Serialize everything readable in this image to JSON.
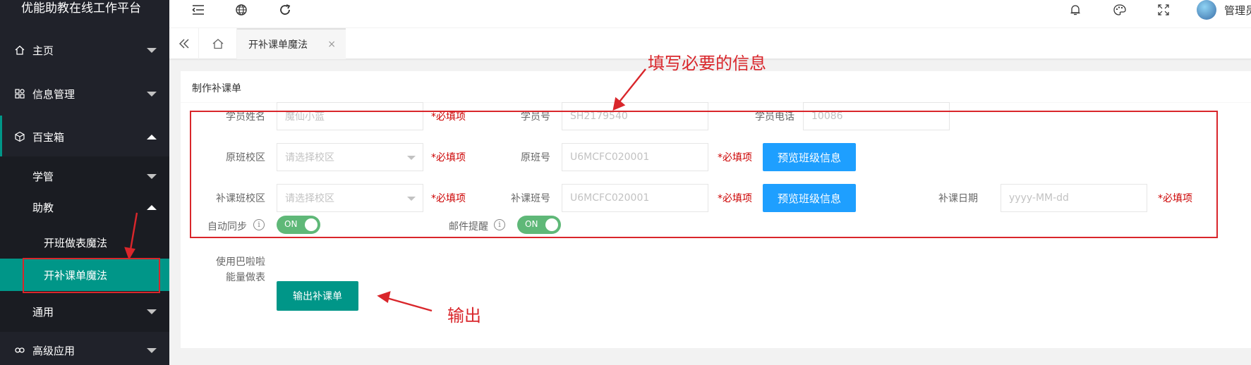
{
  "app": {
    "title": "优能助教在线工作平台"
  },
  "sidebar": {
    "items": [
      {
        "label": "主页",
        "icon": "home-icon",
        "caret": "down"
      },
      {
        "label": "信息管理",
        "icon": "apps-icon",
        "caret": "down"
      },
      {
        "label": "百宝箱",
        "icon": "cube-icon",
        "caret": "up"
      },
      {
        "label": "高级应用",
        "icon": "link-icon",
        "caret": "down"
      }
    ],
    "sub_items": [
      {
        "label": "学管",
        "caret": "down"
      },
      {
        "label": "助教",
        "caret": "up"
      },
      {
        "label": "通用",
        "caret": "down"
      }
    ],
    "sub_sub_items": [
      {
        "label": "开班做表魔法"
      },
      {
        "label": "开补课单魔法"
      }
    ]
  },
  "topbar": {
    "icons": [
      "menu-fold-icon",
      "globe-icon",
      "refresh-icon",
      "bell-icon",
      "palette-icon",
      "fullscreen-icon"
    ],
    "username": "管理员"
  },
  "tabs": {
    "active_tab": "开补课单魔法",
    "close_glyph": "×"
  },
  "card": {
    "title": "制作补课单",
    "fields": {
      "student_name": {
        "label": "学员姓名",
        "placeholder": "魔仙小蓝"
      },
      "student_no": {
        "label": "学员号",
        "placeholder": "SH2179540"
      },
      "student_phone": {
        "label": "学员电话",
        "placeholder": "10086"
      },
      "orig_campus": {
        "label": "原班校区",
        "placeholder": "请选择校区"
      },
      "orig_class_no": {
        "label": "原班号",
        "placeholder": "U6MCFC020001"
      },
      "make_campus": {
        "label": "补课班校区",
        "placeholder": "请选择校区"
      },
      "make_class_no": {
        "label": "补课班号",
        "placeholder": "U6MCFC020001"
      },
      "make_date": {
        "label": "补课日期",
        "placeholder": "yyyy-MM-dd"
      }
    },
    "required_text": "*必填项",
    "preview_button": "预览班级信息",
    "auto_sync": {
      "label": "自动同步",
      "state": "ON"
    },
    "email_remind": {
      "label": "邮件提醒",
      "state": "ON"
    },
    "output_label_1": "使用巴啦啦",
    "output_label_2": "能量做表",
    "output_button": "输出补课单"
  },
  "annotations": {
    "fill_info": "填写必要的信息",
    "output": "输出"
  },
  "colors": {
    "sidebar_bg": "#20222a",
    "accent_green": "#009688",
    "button_blue": "#1e9fff",
    "switch_green": "#5fb878",
    "required_red": "#cc0000",
    "annotation_red": "#d9262b"
  }
}
